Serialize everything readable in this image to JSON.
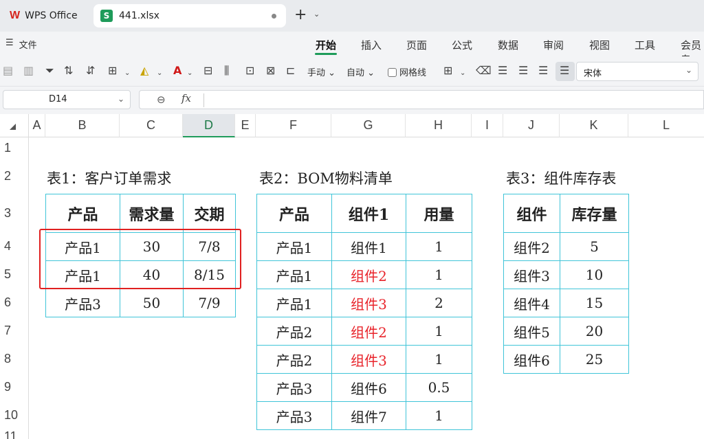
{
  "tabs": {
    "wps_label": "WPS Office",
    "file_label": "441.xlsx",
    "sheet_icon_letter": "S",
    "wps_logo": "W",
    "new_tab": "+",
    "new_tab_menu": "⌄"
  },
  "menu": {
    "file_icon": "☰",
    "file_label": "文件",
    "ribbon_tabs": [
      "开始",
      "插入",
      "页面",
      "公式",
      "数据",
      "审阅",
      "视图",
      "工具",
      "会员专"
    ],
    "active_index": 0
  },
  "toolbar": {
    "wrap_label": "手动",
    "auto_label": "自动",
    "gridlines_label": "网格线",
    "font_name": "宋体",
    "dropdown_icon": "⌄"
  },
  "formula": {
    "cell_ref": "D14",
    "dropdown_icon": "⌄",
    "zoom_icon": "⊖",
    "fx_label": "fx",
    "value": ""
  },
  "grid": {
    "columns": [
      "A",
      "B",
      "C",
      "D",
      "E",
      "F",
      "G",
      "H",
      "I",
      "J",
      "K",
      "L"
    ],
    "selected_column": "D",
    "rows": [
      "1",
      "2",
      "3",
      "4",
      "5",
      "6",
      "7",
      "8",
      "9",
      "10",
      "11"
    ]
  },
  "table1": {
    "title": "表1：客户订单需求",
    "headers": [
      "产品",
      "需求量",
      "交期"
    ],
    "rows": [
      [
        "产品1",
        "30",
        "7/8"
      ],
      [
        "产品1",
        "40",
        "8/15"
      ],
      [
        "产品3",
        "50",
        "7/9"
      ]
    ]
  },
  "table2": {
    "title": "表2：BOM物料清单",
    "headers": [
      "产品",
      "组件1",
      "用量"
    ],
    "rows": [
      [
        "产品1",
        "组件1",
        "1"
      ],
      [
        "产品1",
        "组件2",
        "1"
      ],
      [
        "产品1",
        "组件3",
        "2"
      ],
      [
        "产品2",
        "组件2",
        "1"
      ],
      [
        "产品2",
        "组件3",
        "1"
      ],
      [
        "产品3",
        "组件6",
        "0.5"
      ],
      [
        "产品3",
        "组件7",
        "1"
      ]
    ],
    "red_rows": [
      1,
      2,
      3,
      4
    ]
  },
  "table3": {
    "title": "表3：组件库存表",
    "headers": [
      "组件",
      "库存量"
    ],
    "rows": [
      [
        "组件2",
        "5"
      ],
      [
        "组件3",
        "10"
      ],
      [
        "组件4",
        "15"
      ],
      [
        "组件5",
        "20"
      ],
      [
        "组件6",
        "25"
      ]
    ]
  },
  "colors": {
    "accent": "#1e9b5a",
    "table_border": "#3fc4d8",
    "highlight": "#e02020",
    "red_text": "#e8232a"
  }
}
